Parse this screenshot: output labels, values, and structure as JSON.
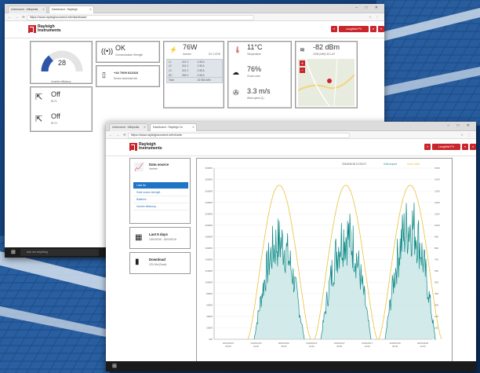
{
  "background": {
    "sky": "#0f3d78",
    "panel": "#2b5f9e",
    "frame": "#c9d7e8"
  },
  "colors": {
    "brand_red": "#c9252c",
    "teal": "#0e8a86",
    "gold": "#e8c33a",
    "blue": "#1e75c7"
  },
  "win1": {
    "tabs": [
      "Unbenannt - Wikipedia",
      "Dashboard - Rayleigh"
    ],
    "url": "https://www.rayleighconnect.net/dashboard",
    "logo": {
      "line1": "Rayleigh",
      "line2": "Instruments"
    },
    "header_buttons": [
      "Langfield PV Inverter"
    ],
    "gauge": {
      "value": "28",
      "label": "Inverter efficiency",
      "fraction": 0.28
    },
    "comm": {
      "status": "OK",
      "label": "Communication Strength"
    },
    "phone": {
      "number": "+44 7909 623416",
      "label": "Device download link"
    },
    "relay1": {
      "state": "Off",
      "label": "RLY1"
    },
    "relay2": {
      "state": "Off",
      "label": "RLY2"
    },
    "power": {
      "value": "76W",
      "label": "Inverter",
      "sub": "DC 2 ATW"
    },
    "power_table": [
      [
        "L1",
        "241 V",
        "0.35 A"
      ],
      [
        "L2",
        "241 V",
        "0.35 A"
      ],
      [
        "L3",
        "241 V",
        "0.35 A"
      ],
      [
        "DC",
        "269 V",
        "0.35 A"
      ],
      [
        "Total",
        "",
        "43 554 kWh"
      ]
    ],
    "temperature": {
      "value": "11°C",
      "label": "Temperature"
    },
    "cloud": {
      "value": "76%",
      "label": "Cloud cover"
    },
    "wind": {
      "value": "3.3 m/s",
      "label": "Wind speed (1)"
    },
    "signal": {
      "value": "-82 dBm",
      "label": "GSM (N/W) 3G LAT"
    },
    "taskbar_search": "Ask me anything"
  },
  "win2": {
    "tabs": [
      "Unbenannt - Wikipedia",
      "Dashboard - Rayleigh Co"
    ],
    "url": "https://www.rayleighconnect.net/charts",
    "header_buttons": [
      "Langfield PV Inverter"
    ],
    "data_source": {
      "title": "Data source",
      "subtitle": "Inverter",
      "items": [
        "Load kw",
        "Solar source strength",
        "Batteries",
        "Inverter efficiency"
      ]
    },
    "period": {
      "title": "Last 5 days",
      "subtitle": "13/04/2016 - 18/04/2016"
    },
    "download": {
      "title": "Download",
      "subtitle": "CSV file (Excel)"
    }
  },
  "chart_data": {
    "type": "line",
    "title": "",
    "header_text": "2016/04/18 12:00:07",
    "series": [
      {
        "name": "Grid export",
        "color": "#0e8a86",
        "values_note": "noisy daily peaks"
      },
      {
        "name": "Solar ideal",
        "color": "#e8c33a"
      }
    ],
    "x_labels": [
      "2016/04/15 00:00",
      "2016/04/15 12:00",
      "2016/04/16 00:00",
      "2016/04/16 12:00",
      "2016/04/17 00:00",
      "2016/04/17 12:00",
      "2016/04/18 00:00",
      "2016/04/18 12:00"
    ],
    "y_left_ticks": [
      "0W",
      "200W",
      "400W",
      "600W",
      "800W",
      "1000W",
      "1200W",
      "1400W",
      "1600W",
      "1800W",
      "2000W",
      "2200W",
      "2400W",
      "2600W",
      "2800W",
      "3000W"
    ],
    "y_right_ticks": [
      "0",
      "100",
      "200",
      "300",
      "400",
      "500",
      "600",
      "700",
      "800",
      "900",
      "1000",
      "1100",
      "1200",
      "1300",
      "1400",
      "1500"
    ],
    "day_peaks_teal": [
      0.73,
      0.78,
      0.86
    ],
    "day_peaks_gold": [
      0.9,
      0.9,
      0.9
    ],
    "ylim": [
      0,
      3000
    ]
  }
}
